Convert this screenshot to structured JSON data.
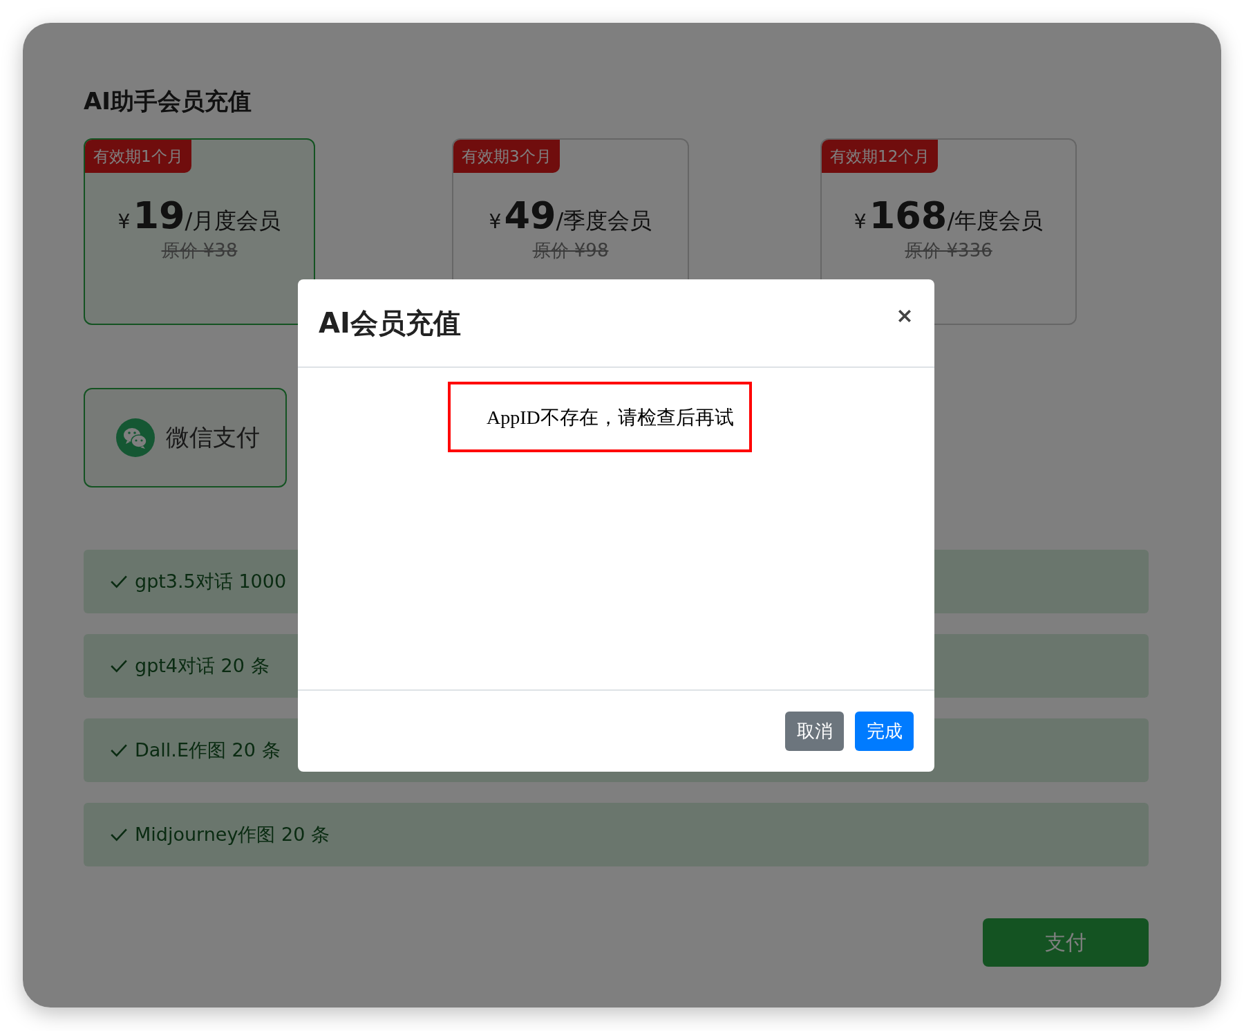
{
  "page": {
    "title": "AI助手会员充值"
  },
  "plans": [
    {
      "badge": "有效期1个月",
      "currency": "¥",
      "price": "19",
      "unit": "/月度会员",
      "original_price": "原价 ¥38",
      "selected": true
    },
    {
      "badge": "有效期3个月",
      "currency": "¥",
      "price": "49",
      "unit": "/季度会员",
      "original_price": "原价 ¥98",
      "selected": false
    },
    {
      "badge": "有效期12个月",
      "currency": "¥",
      "price": "168",
      "unit": "/年度会员",
      "original_price": "原价 ¥336",
      "selected": false
    }
  ],
  "payment_methods": [
    {
      "label": "微信支付",
      "selected": true
    }
  ],
  "features": [
    "gpt3.5对话 1000",
    "gpt4对话 20 条",
    "Dall.E作图 20 条",
    "Midjourney作图 20 条"
  ],
  "pay_button": "支付",
  "dialog": {
    "title": "AI会员充值",
    "message": "AppID不存在，请检查后再试",
    "buttons": [
      {
        "label": "取消",
        "kind": "secondary"
      },
      {
        "label": "完成",
        "kind": "primary"
      }
    ]
  }
}
